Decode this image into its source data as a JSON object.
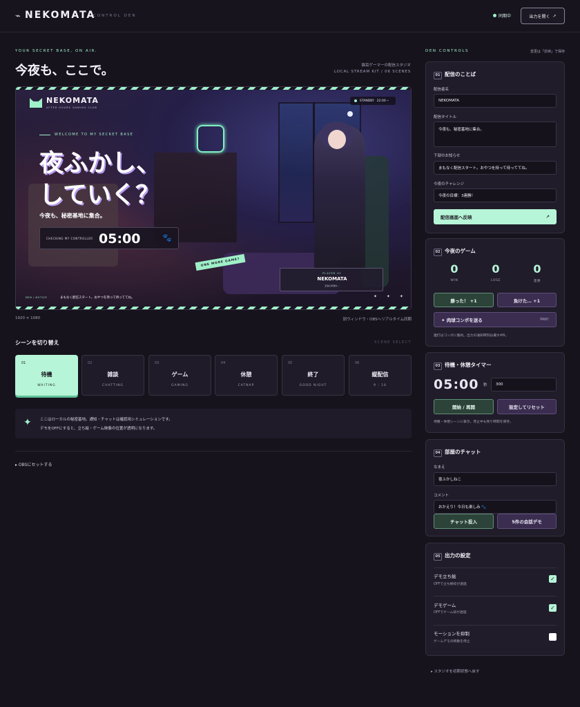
{
  "header": {
    "logo_glyph": "⌁",
    "brand": "NEKOMATA",
    "subtitle": "CONTROL DEN",
    "status": "同期中",
    "open_button": "出力を開く",
    "open_icon": "↗"
  },
  "hero": {
    "kicker": "YOUR SECRET BASE, ON AIR.",
    "title": "今夜も、ここで。",
    "meta_line1": "猫耳ゲーマーの配信スタジオ",
    "meta_line2": "LOCAL STREAM KIT / 06 SCENES"
  },
  "preview": {
    "brand": "NEKOMATA",
    "brand_sub": "AFTER HOURS GAMING CLUB",
    "status": "STANDBY",
    "clock": "22:00 ─",
    "welcome": "WELCOME TO MY SECRET BASE",
    "title_line1": "夜ふかし、",
    "title_line2": "していく？",
    "subtitle": "今夜も、秘密基地に集合。",
    "timer_label": "CHECKING MY CONTROLLER",
    "timer": "05:00",
    "paw_icon": "🐾",
    "tag": "ONE MORE GAME?",
    "player_label": "PLAYER 01",
    "player_name": "NEKOMATA",
    "player_sub": "配信の準備中…",
    "notice_label": "DEN / NOTICE",
    "notice": "まもなく配信スタート。おやつを持って待っててね。",
    "sparkles": "✦ ✦ ✦",
    "resolution": "1920 × 1080",
    "sync_note": "別ウィンドウ・OBSへリアルタイム同期"
  },
  "scenes": {
    "heading": "シーンを切り替え",
    "heading_en": "SCENE SELECT",
    "items": [
      {
        "num": "01",
        "label": "待機",
        "en": "WAITING",
        "active": true
      },
      {
        "num": "02",
        "label": "雑談",
        "en": "CHATTING",
        "active": false
      },
      {
        "num": "03",
        "label": "ゲーム",
        "en": "GAMING",
        "active": false
      },
      {
        "num": "04",
        "label": "休憩",
        "en": "CATNAP",
        "active": false
      },
      {
        "num": "05",
        "label": "終了",
        "en": "GOOD NIGHT",
        "active": false
      },
      {
        "num": "06",
        "label": "縦配信",
        "en": "9 : 16",
        "active": false
      }
    ]
  },
  "info": {
    "icon": "✦",
    "line1": "ここはローカルの秘密基地。通知・チャットは確認用シミュレーションです。",
    "line2": "デモをOFFにすると、立ち絵・ゲーム映像の位置が透明になります。"
  },
  "obs_link": "▸ OBSにセットする",
  "den": {
    "heading": "DEN CONTROLS",
    "note": "変更は「反映」で保存"
  },
  "card_stream": {
    "num": "01",
    "title": "配信のことば",
    "name_label": "配信者名",
    "name_value": "NEKOMATA",
    "title_label": "配信タイトル",
    "title_value": "今夜も、秘密基地に集合。",
    "notice_label": "下部のお知らせ",
    "notice_value": "まもなく配信スタート。おやつを持って待っててね。",
    "challenge_label": "今夜のチャレンジ",
    "challenge_value": "今夜の目標：3連勝！",
    "apply_button": "配信画面へ反映",
    "apply_icon": "↗"
  },
  "card_game": {
    "num": "02",
    "title": "今夜のゲーム",
    "stats": [
      {
        "value": "0",
        "label": "WIN"
      },
      {
        "value": "0",
        "label": "LOSE"
      },
      {
        "value": "0",
        "label": "連勝"
      }
    ],
    "win_button": "勝った！ +1",
    "lose_button": "負けた… +1",
    "combo_button": "✦ 肉球コンボを送る",
    "combo_tag": "PAW!",
    "note": "連打はコンボに集約。出力の通知時刻は最大4件。"
  },
  "card_timer": {
    "num": "03",
    "title": "待機・休憩タイマー",
    "display": "05:00",
    "sec_label": "秒",
    "seconds_value": "300",
    "start_button": "開始 / 再開",
    "reset_button": "設定してリセット",
    "note": "待機・休憩シーンに表示。停止中も残り時間を保存。"
  },
  "card_chat": {
    "num": "04",
    "title": "部屋のチャット",
    "name_label": "なまえ",
    "name_value": "夜ふかしねこ",
    "comment_label": "コメント",
    "comment_value": "おかえり！今日も楽しみ 🐾",
    "send_button": "チャット投入",
    "demo_button": "5件の会話デモ"
  },
  "card_output": {
    "num": "05",
    "title": "出力の設定",
    "options": [
      {
        "label": "デモ立ち絵",
        "sub": "OFFで立ち絵枠が透過",
        "checked": true
      },
      {
        "label": "デモゲーム",
        "sub": "OFFでゲーム枠が透過",
        "checked": true
      },
      {
        "label": "モーションを抑制",
        "sub": "ゲームデモの移動を停止",
        "checked": false
      }
    ]
  },
  "reset_link": "▸ スタジオを初期状態へ戻す"
}
